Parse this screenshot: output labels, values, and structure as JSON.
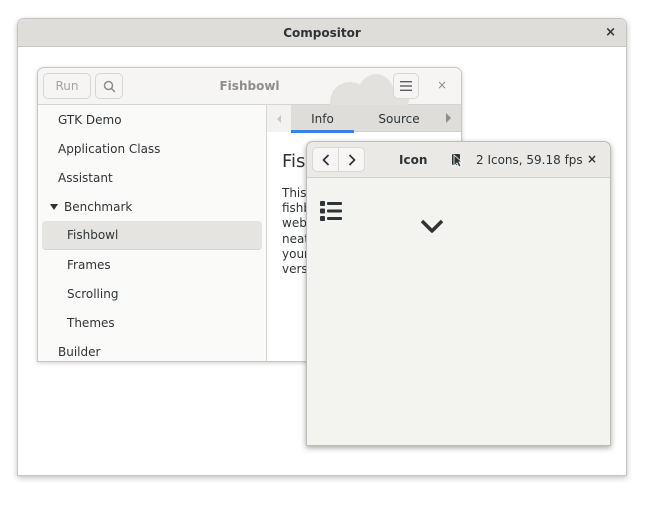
{
  "compositor": {
    "title": "Compositor",
    "close_label": "×"
  },
  "fishbowl_window": {
    "title": "Fishbowl",
    "run_label": "Run",
    "close_label": "×",
    "sidebar": {
      "items": [
        {
          "label": "GTK Demo",
          "level": 0
        },
        {
          "label": "Application Class",
          "level": 0
        },
        {
          "label": "Assistant",
          "level": 0
        },
        {
          "label": "Benchmark",
          "level": 0,
          "expanded": true
        },
        {
          "label": "Fishbowl",
          "level": 1,
          "selected": true
        },
        {
          "label": "Frames",
          "level": 1
        },
        {
          "label": "Scrolling",
          "level": 1
        },
        {
          "label": "Themes",
          "level": 1
        },
        {
          "label": "Builder",
          "level": 0
        }
      ]
    },
    "tabs": [
      {
        "label": "Info",
        "active": true
      },
      {
        "label": "Source",
        "active": false
      }
    ],
    "info": {
      "title": "Fis",
      "text_lines": [
        "This",
        "fishb",
        "web",
        "neat",
        "your",
        "versi"
      ]
    }
  },
  "icon_window": {
    "title": "Icon",
    "status": "2 Icons, 59.18 fps",
    "close_label": "×"
  },
  "colors": {
    "accent": "#3584e4",
    "header_bg": "#deddda"
  }
}
